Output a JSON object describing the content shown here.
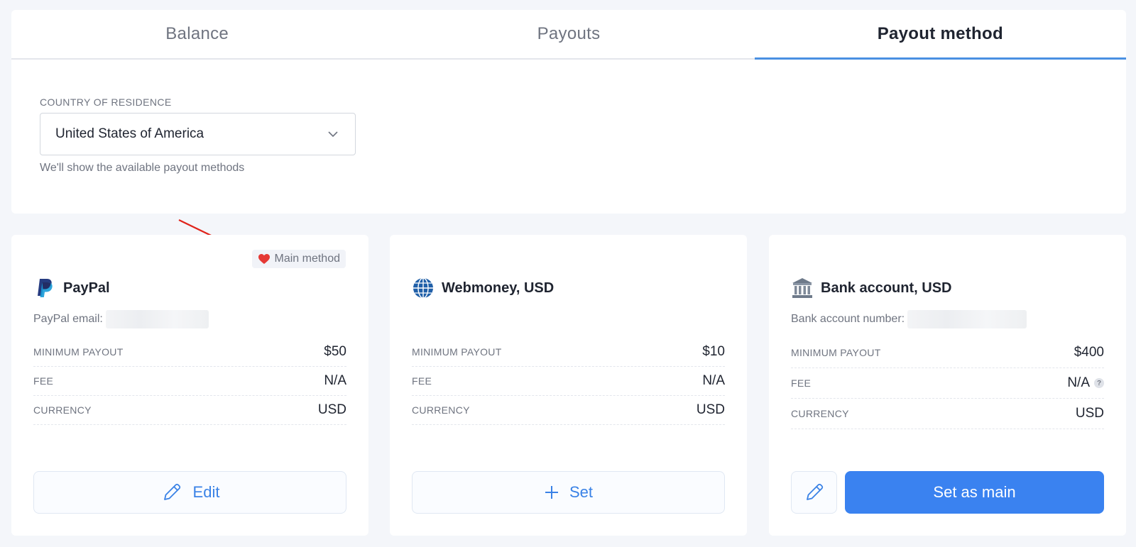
{
  "tabs": [
    {
      "label": "Balance",
      "active": false
    },
    {
      "label": "Payouts",
      "active": false
    },
    {
      "label": "Payout method",
      "active": true
    }
  ],
  "country": {
    "label": "COUNTRY OF RESIDENCE",
    "value": "United States of America",
    "hint": "We'll show the available payout methods"
  },
  "colors": {
    "accent": "#3a82f0",
    "tab_underline": "#4a90e2",
    "badge_heart": "#e53935",
    "annotation_arrow": "#e0241b"
  },
  "cards": [
    {
      "badge": "Main method",
      "name": "PayPal",
      "icon": "paypal-icon",
      "sub_label": "PayPal email:",
      "rows": [
        {
          "label": "MINIMUM PAYOUT",
          "value": "$50"
        },
        {
          "label": "FEE",
          "value": "N/A"
        },
        {
          "label": "CURRENCY",
          "value": "USD"
        }
      ],
      "button": "Edit"
    },
    {
      "name": "Webmoney, USD",
      "icon": "webmoney-icon",
      "rows": [
        {
          "label": "MINIMUM PAYOUT",
          "value": "$10"
        },
        {
          "label": "FEE",
          "value": "N/A"
        },
        {
          "label": "CURRENCY",
          "value": "USD"
        }
      ],
      "button": "Set"
    },
    {
      "name": "Bank account, USD",
      "icon": "bank-icon",
      "sub_label": "Bank account number:",
      "rows": [
        {
          "label": "MINIMUM PAYOUT",
          "value": "$400"
        },
        {
          "label": "FEE",
          "value": "N/A"
        },
        {
          "label": "CURRENCY",
          "value": "USD"
        }
      ],
      "fee_help": "?",
      "button": "Set as main"
    }
  ]
}
